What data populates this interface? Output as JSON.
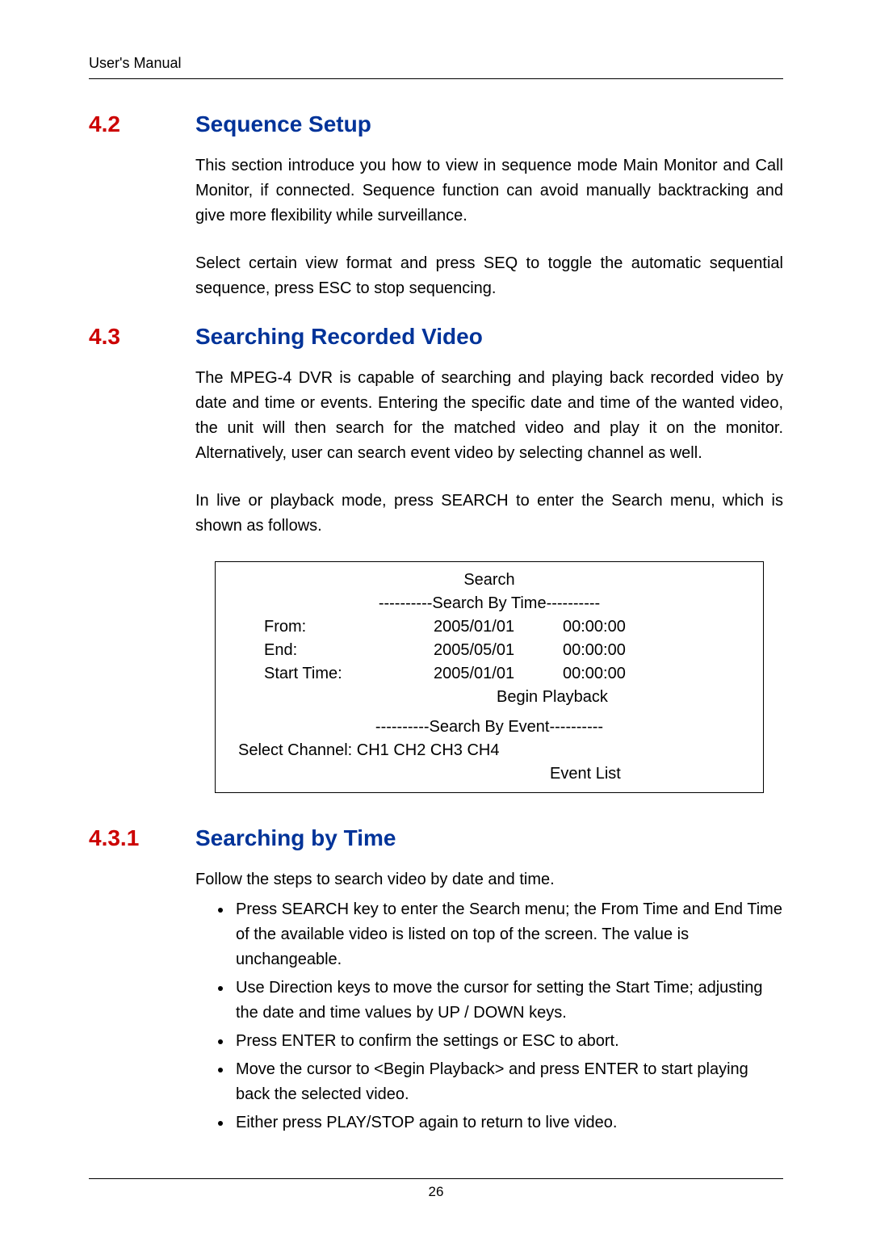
{
  "header": {
    "label": "User's Manual"
  },
  "sections": {
    "s42": {
      "num": "4.2",
      "title": "Sequence Setup",
      "p1": "This section introduce you how to view in sequence mode Main Monitor and Call Monitor, if connected. Sequence function can avoid manually backtracking and give more flexibility while surveillance.",
      "p2": "Select certain view format and press SEQ to toggle the automatic sequential sequence, press ESC to stop sequencing."
    },
    "s43": {
      "num": "4.3",
      "title": "Searching Recorded Video",
      "p1": "The MPEG-4 DVR is capable of searching and playing back recorded video by date and time or events. Entering the specific date and time of the wanted video, the unit will then search for the matched video and play it on the monitor. Alternatively, user can search event video by selecting channel as well.",
      "p2": "In live or playback mode, press SEARCH to enter the Search menu, which is shown as follows."
    },
    "s431": {
      "num": "4.3.1",
      "title": "Searching by Time",
      "intro": "Follow the steps to search video by date and time.",
      "b1": "Press SEARCH key to enter the Search menu; the From Time and End Time of the available video is listed on top of the screen. The value is unchangeable.",
      "b2": "Use Direction keys to move the cursor for setting the Start Time; adjusting the date and time values by UP / DOWN keys.",
      "b3": "Press ENTER to confirm the settings or ESC to abort.",
      "b4": "Move the cursor to <Begin Playback> and press ENTER to start playing back the selected video.",
      "b5": "Either press PLAY/STOP again to return to live video."
    }
  },
  "searchbox": {
    "title": "Search",
    "byTime": "----------Search By Time----------",
    "fromLabel": "From:",
    "fromDate": "2005/01/01",
    "fromTime": "00:00:00",
    "endLabel": "End:",
    "endDate": "2005/05/01",
    "endTime": "00:00:00",
    "startLabel": "Start Time:",
    "startDate": "2005/01/01",
    "startTime": "00:00:00",
    "begin": "Begin  Playback",
    "byEvent": "----------Search By Event----------",
    "selectChannel": "Select Channel:    CH1   CH2   CH3   CH4",
    "eventList": "Event  List"
  },
  "footer": {
    "pagenum": "26"
  }
}
